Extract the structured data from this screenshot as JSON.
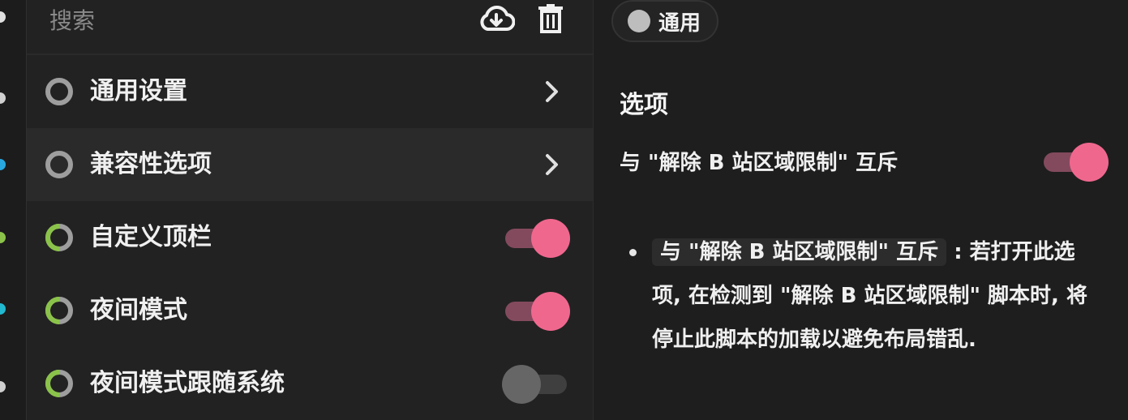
{
  "sidebar": {
    "search_placeholder": "搜索",
    "items": [
      {
        "label": "通用设置",
        "type": "nav",
        "icon": "ring-icon"
      },
      {
        "label": "兼容性选项",
        "type": "nav",
        "icon": "ring-icon",
        "active": true
      },
      {
        "label": "自定义顶栏",
        "type": "toggle",
        "icon": "ring-partial-icon",
        "enabled": true
      },
      {
        "label": "夜间模式",
        "type": "toggle",
        "icon": "ring-partial-icon",
        "enabled": true
      },
      {
        "label": "夜间模式跟随系统",
        "type": "toggle",
        "icon": "ring-partial-icon",
        "enabled": false
      }
    ]
  },
  "detail": {
    "chip_label": "通用",
    "section_title": "选项",
    "option": {
      "label": "与 \"解除 B 站区域限制\" 互斥",
      "enabled": true
    },
    "description": {
      "code": "与 \"解除 B 站区域限制\" 互斥",
      "text": ": 若打开此选项, 在检测到 \"解除 B 站区域限制\" 脚本时, 将停止此脚本的加载以避免布局错乱."
    }
  },
  "colors": {
    "accent": "#f0678e",
    "accent_track": "#834a5e",
    "ring_green": "#8bc34a",
    "ring_gray": "#9e9e9e"
  }
}
